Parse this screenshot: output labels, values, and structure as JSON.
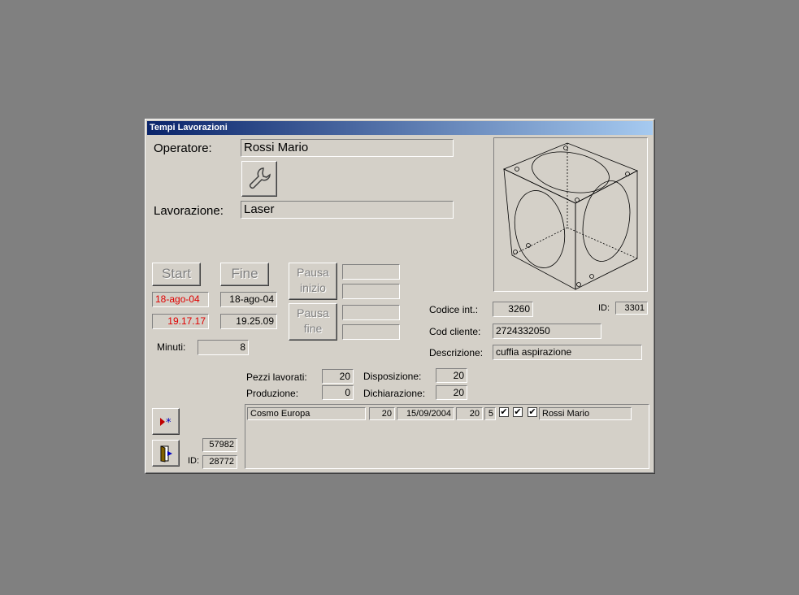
{
  "window": {
    "title": "Tempi Lavorazioni"
  },
  "operator": {
    "label": "Operatore:",
    "value": "Rossi Mario"
  },
  "lavorazione": {
    "label": "Lavorazione:",
    "value": "Laser"
  },
  "buttons": {
    "start": "Start",
    "fine": "Fine",
    "pausa_inizio": [
      "Pausa",
      "inizio"
    ],
    "pausa_fine": [
      "Pausa",
      "fine"
    ]
  },
  "times": {
    "start_date": "18-ago-04",
    "start_time": "19.17.17",
    "end_date": "18-ago-04",
    "end_time": "19.25.09"
  },
  "minuti": {
    "label": "Minuti:",
    "value": "8"
  },
  "info": {
    "codice_label": "Codice  int.:",
    "codice_value": "3260",
    "id_label": "ID:",
    "id_value": "3301",
    "cod_cliente_label": "Cod cliente:",
    "cod_cliente_value": "2724332050",
    "descrizione_label": "Descrizione:",
    "descrizione_value": "cuffia aspirazione"
  },
  "counts": {
    "pezzi_label": "Pezzi lavorati:",
    "pezzi_value": "20",
    "produzione_label": "Produzione:",
    "produzione_value": "0",
    "disposizione_label": "Disposizione:",
    "disposizione_value": "20",
    "dichiarazione_label": "Dichiarazione:",
    "dichiarazione_value": "20"
  },
  "footer": {
    "number": "57982",
    "id_label": "ID:",
    "id_value": "28772"
  },
  "subform_row": {
    "cliente": "Cosmo Europa",
    "qty": "20",
    "date": "15/09/2004",
    "qty2": "20",
    "n": "5",
    "check1": "✔",
    "check2": "✔",
    "check3": "✔",
    "operator": "Rossi Mario"
  },
  "icons": {
    "wrench": "wrench-icon",
    "new_record": "new-record-icon",
    "exit": "exit-door-icon"
  },
  "colors": {
    "titlebar_start": "#0a246a",
    "titlebar_end": "#a6caf0",
    "red_text": "#e00000"
  }
}
